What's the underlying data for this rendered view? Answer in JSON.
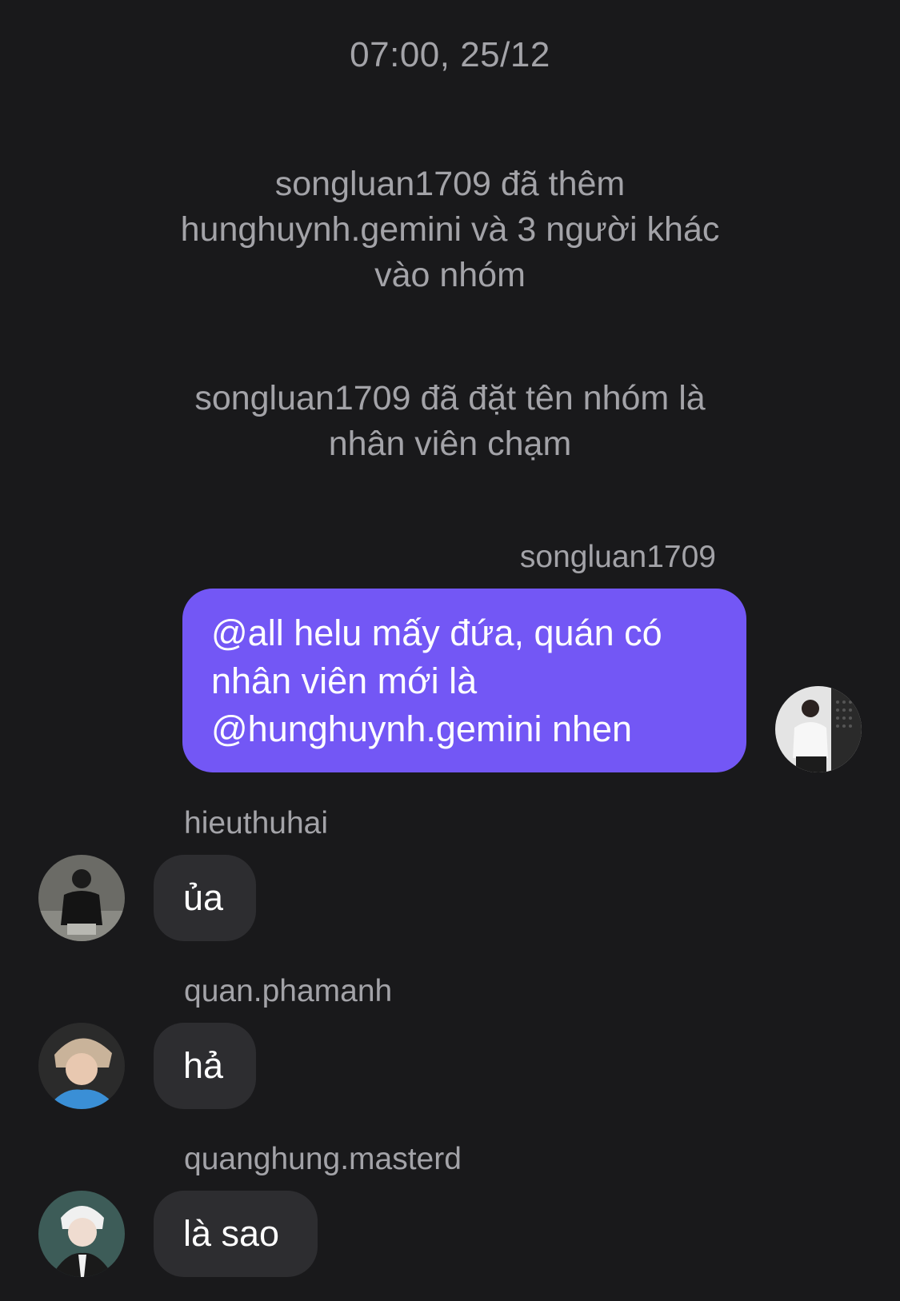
{
  "timestamp": "07:00, 25/12",
  "system_messages": [
    {
      "lines": [
        "songluan1709 đã thêm",
        "hunghuynh.gemini và 3 người khác",
        "vào nhóm"
      ]
    },
    {
      "lines": [
        "songluan1709 đã đặt tên nhóm là",
        "nhân viên chạm"
      ]
    }
  ],
  "messages": [
    {
      "sender": "songluan1709",
      "direction": "outgoing",
      "lines": [
        "@all helu mấy đứa, quán có",
        "nhân viên mới là",
        "@hunghuynh.gemini nhen"
      ],
      "avatar": "user-avatar-photo"
    },
    {
      "sender": "hieuthuhai",
      "direction": "incoming",
      "text": "ủa",
      "avatar": "user-avatar-photo"
    },
    {
      "sender": "quan.phamanh",
      "direction": "incoming",
      "text": "hả",
      "avatar": "user-avatar-photo"
    },
    {
      "sender": "quanghung.masterd",
      "direction": "incoming",
      "text": "là sao",
      "avatar": "user-avatar-photo"
    }
  ],
  "colors": {
    "background": "#19191b",
    "outgoing_bubble": "#7357f5",
    "incoming_bubble": "#2d2d30",
    "secondary_text": "#a3a3a8"
  }
}
